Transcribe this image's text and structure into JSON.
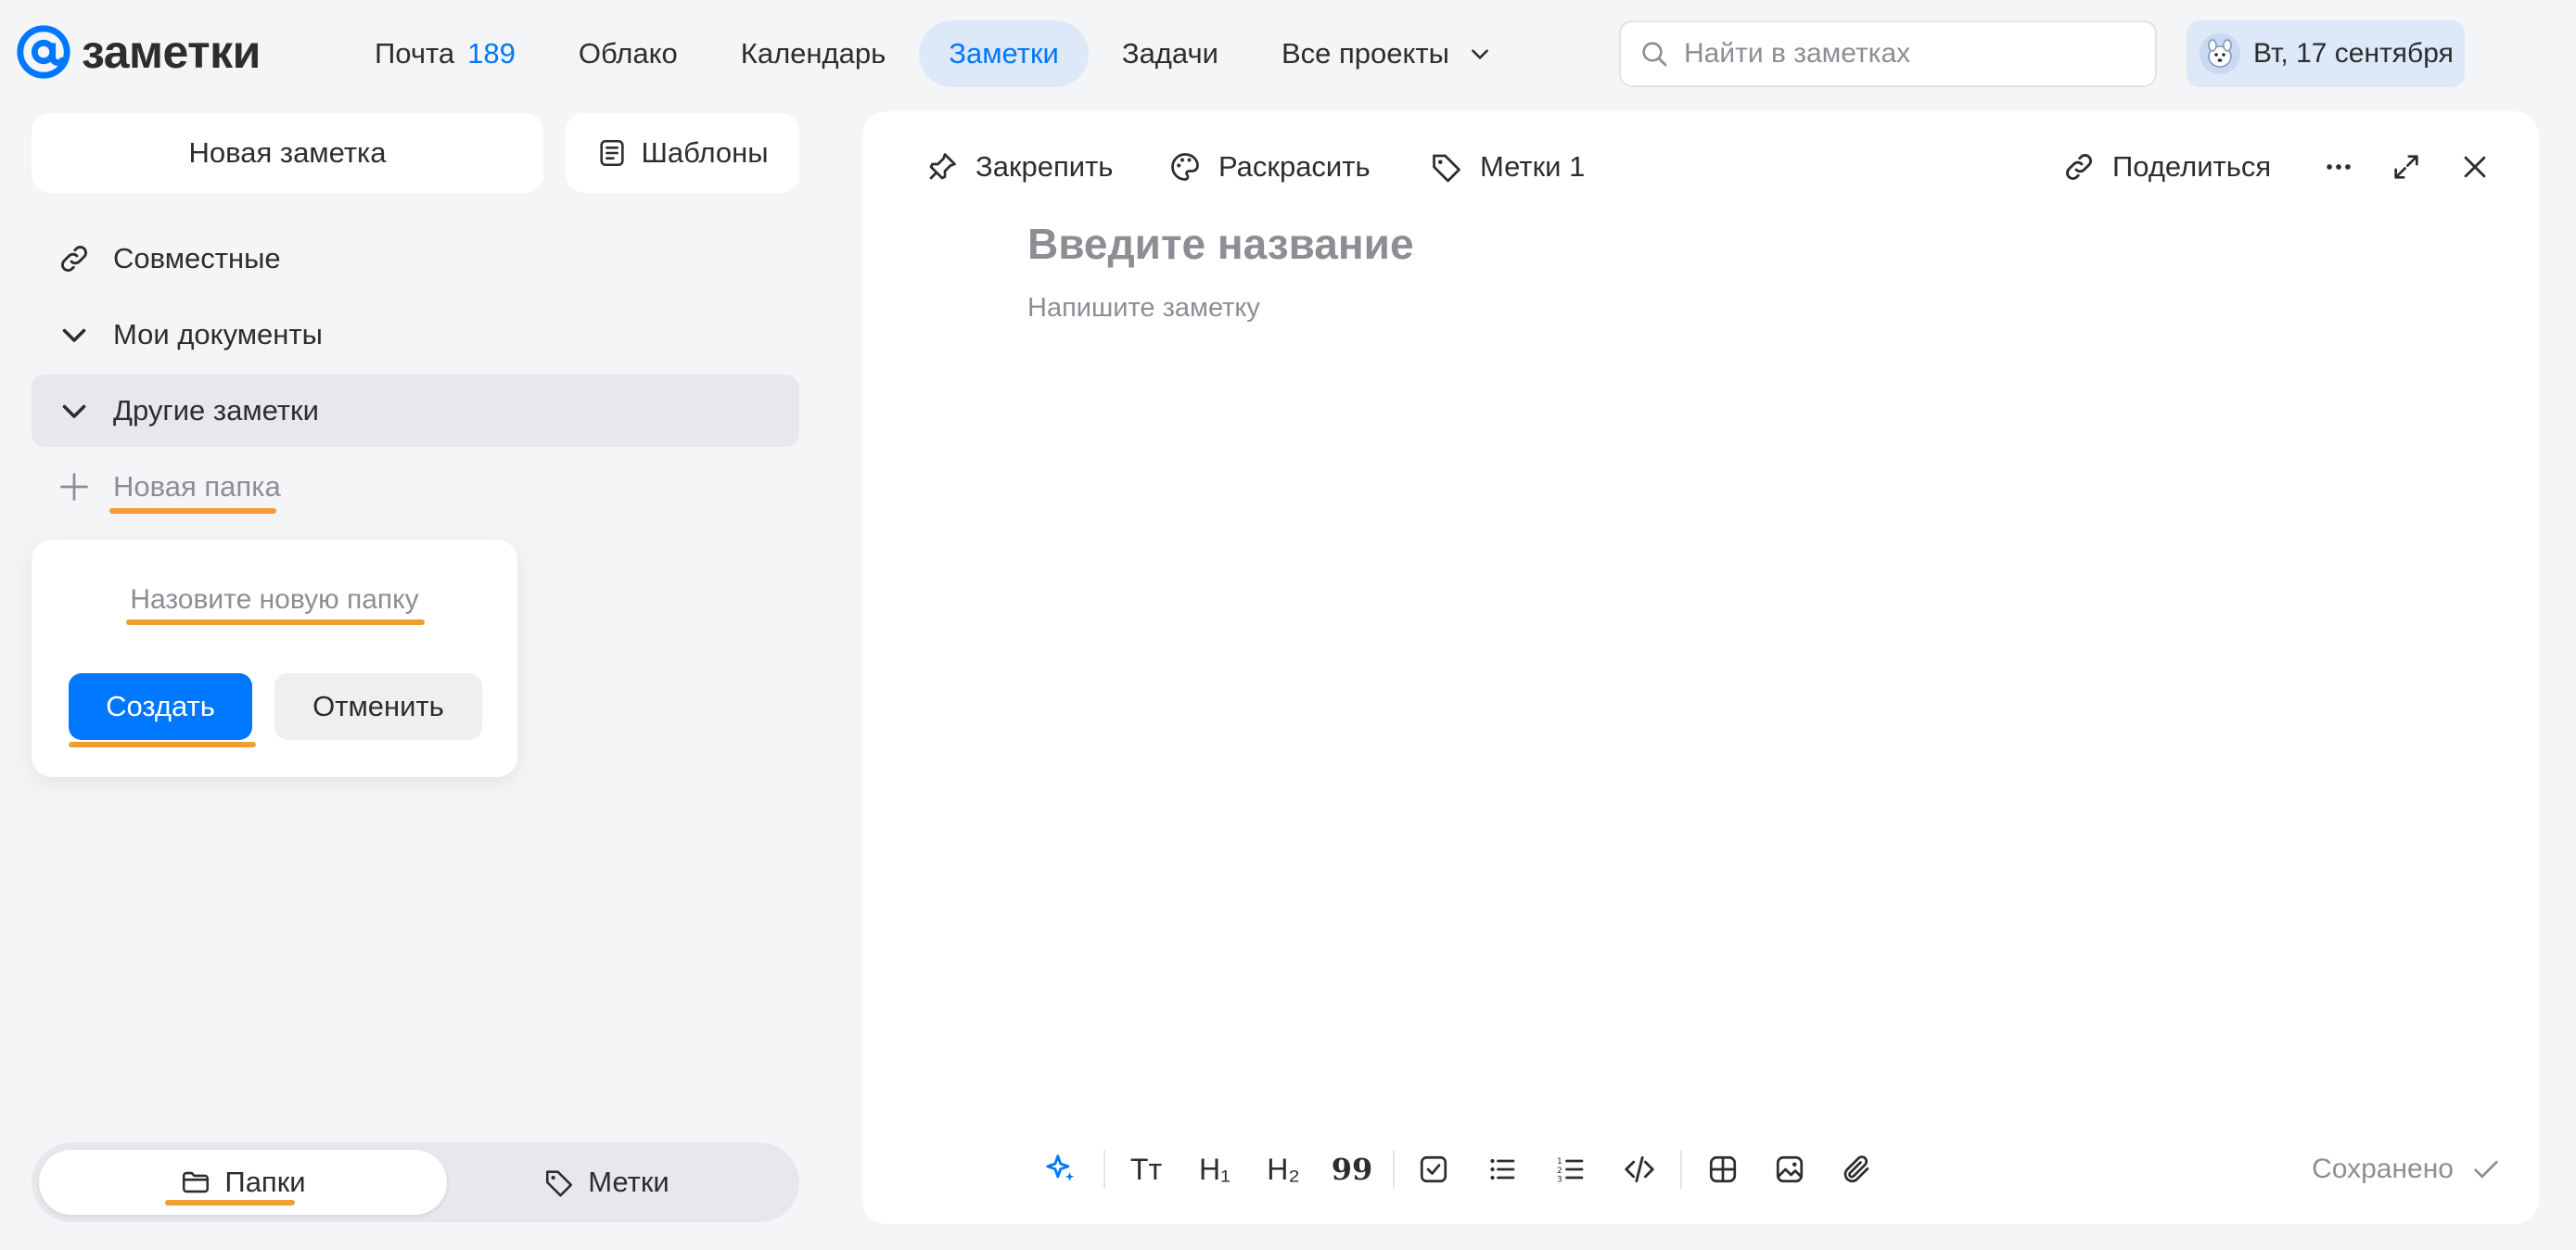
{
  "header": {
    "logo_text": "заметки",
    "nav": [
      {
        "label": "Почта",
        "count": "189"
      },
      {
        "label": "Облако"
      },
      {
        "label": "Календарь"
      },
      {
        "label": "Заметки",
        "active": true
      },
      {
        "label": "Задачи"
      },
      {
        "label": "Все проекты"
      }
    ],
    "search_placeholder": "Найти в заметках",
    "date": "Вт, 17 сентября"
  },
  "sidebar": {
    "new_note_label": "Новая заметка",
    "templates_label": "Шаблоны",
    "items": [
      {
        "label": "Совместные",
        "icon": "link-icon"
      },
      {
        "label": "Мои документы",
        "icon": "chevron-down-icon"
      },
      {
        "label": "Другие заметки",
        "icon": "chevron-down-icon",
        "active": true
      },
      {
        "label": "Новая папка",
        "icon": "plus-icon"
      }
    ],
    "popup": {
      "input_placeholder": "Назовите новую папку",
      "create_label": "Создать",
      "cancel_label": "Отменить"
    },
    "tabs": [
      {
        "label": "Папки",
        "icon": "folder-icon",
        "active": true
      },
      {
        "label": "Метки",
        "icon": "tag-icon"
      }
    ]
  },
  "editor": {
    "toolbar": {
      "pin_label": "Закрепить",
      "color_label": "Раскрасить",
      "tags_label": "Метки 1",
      "share_label": "Поделиться"
    },
    "title_placeholder": "Введите название",
    "body_placeholder": "Напишите заметку",
    "format": {
      "text_size": "Тт",
      "h1": "H₁",
      "h2": "H₂",
      "quote": "99"
    },
    "saved_label": "Сохранено"
  },
  "colors": {
    "accent": "#0077ff",
    "highlight": "#f29e2e",
    "nav_active_bg": "#dde8f8",
    "background": "#f4f5f7"
  }
}
